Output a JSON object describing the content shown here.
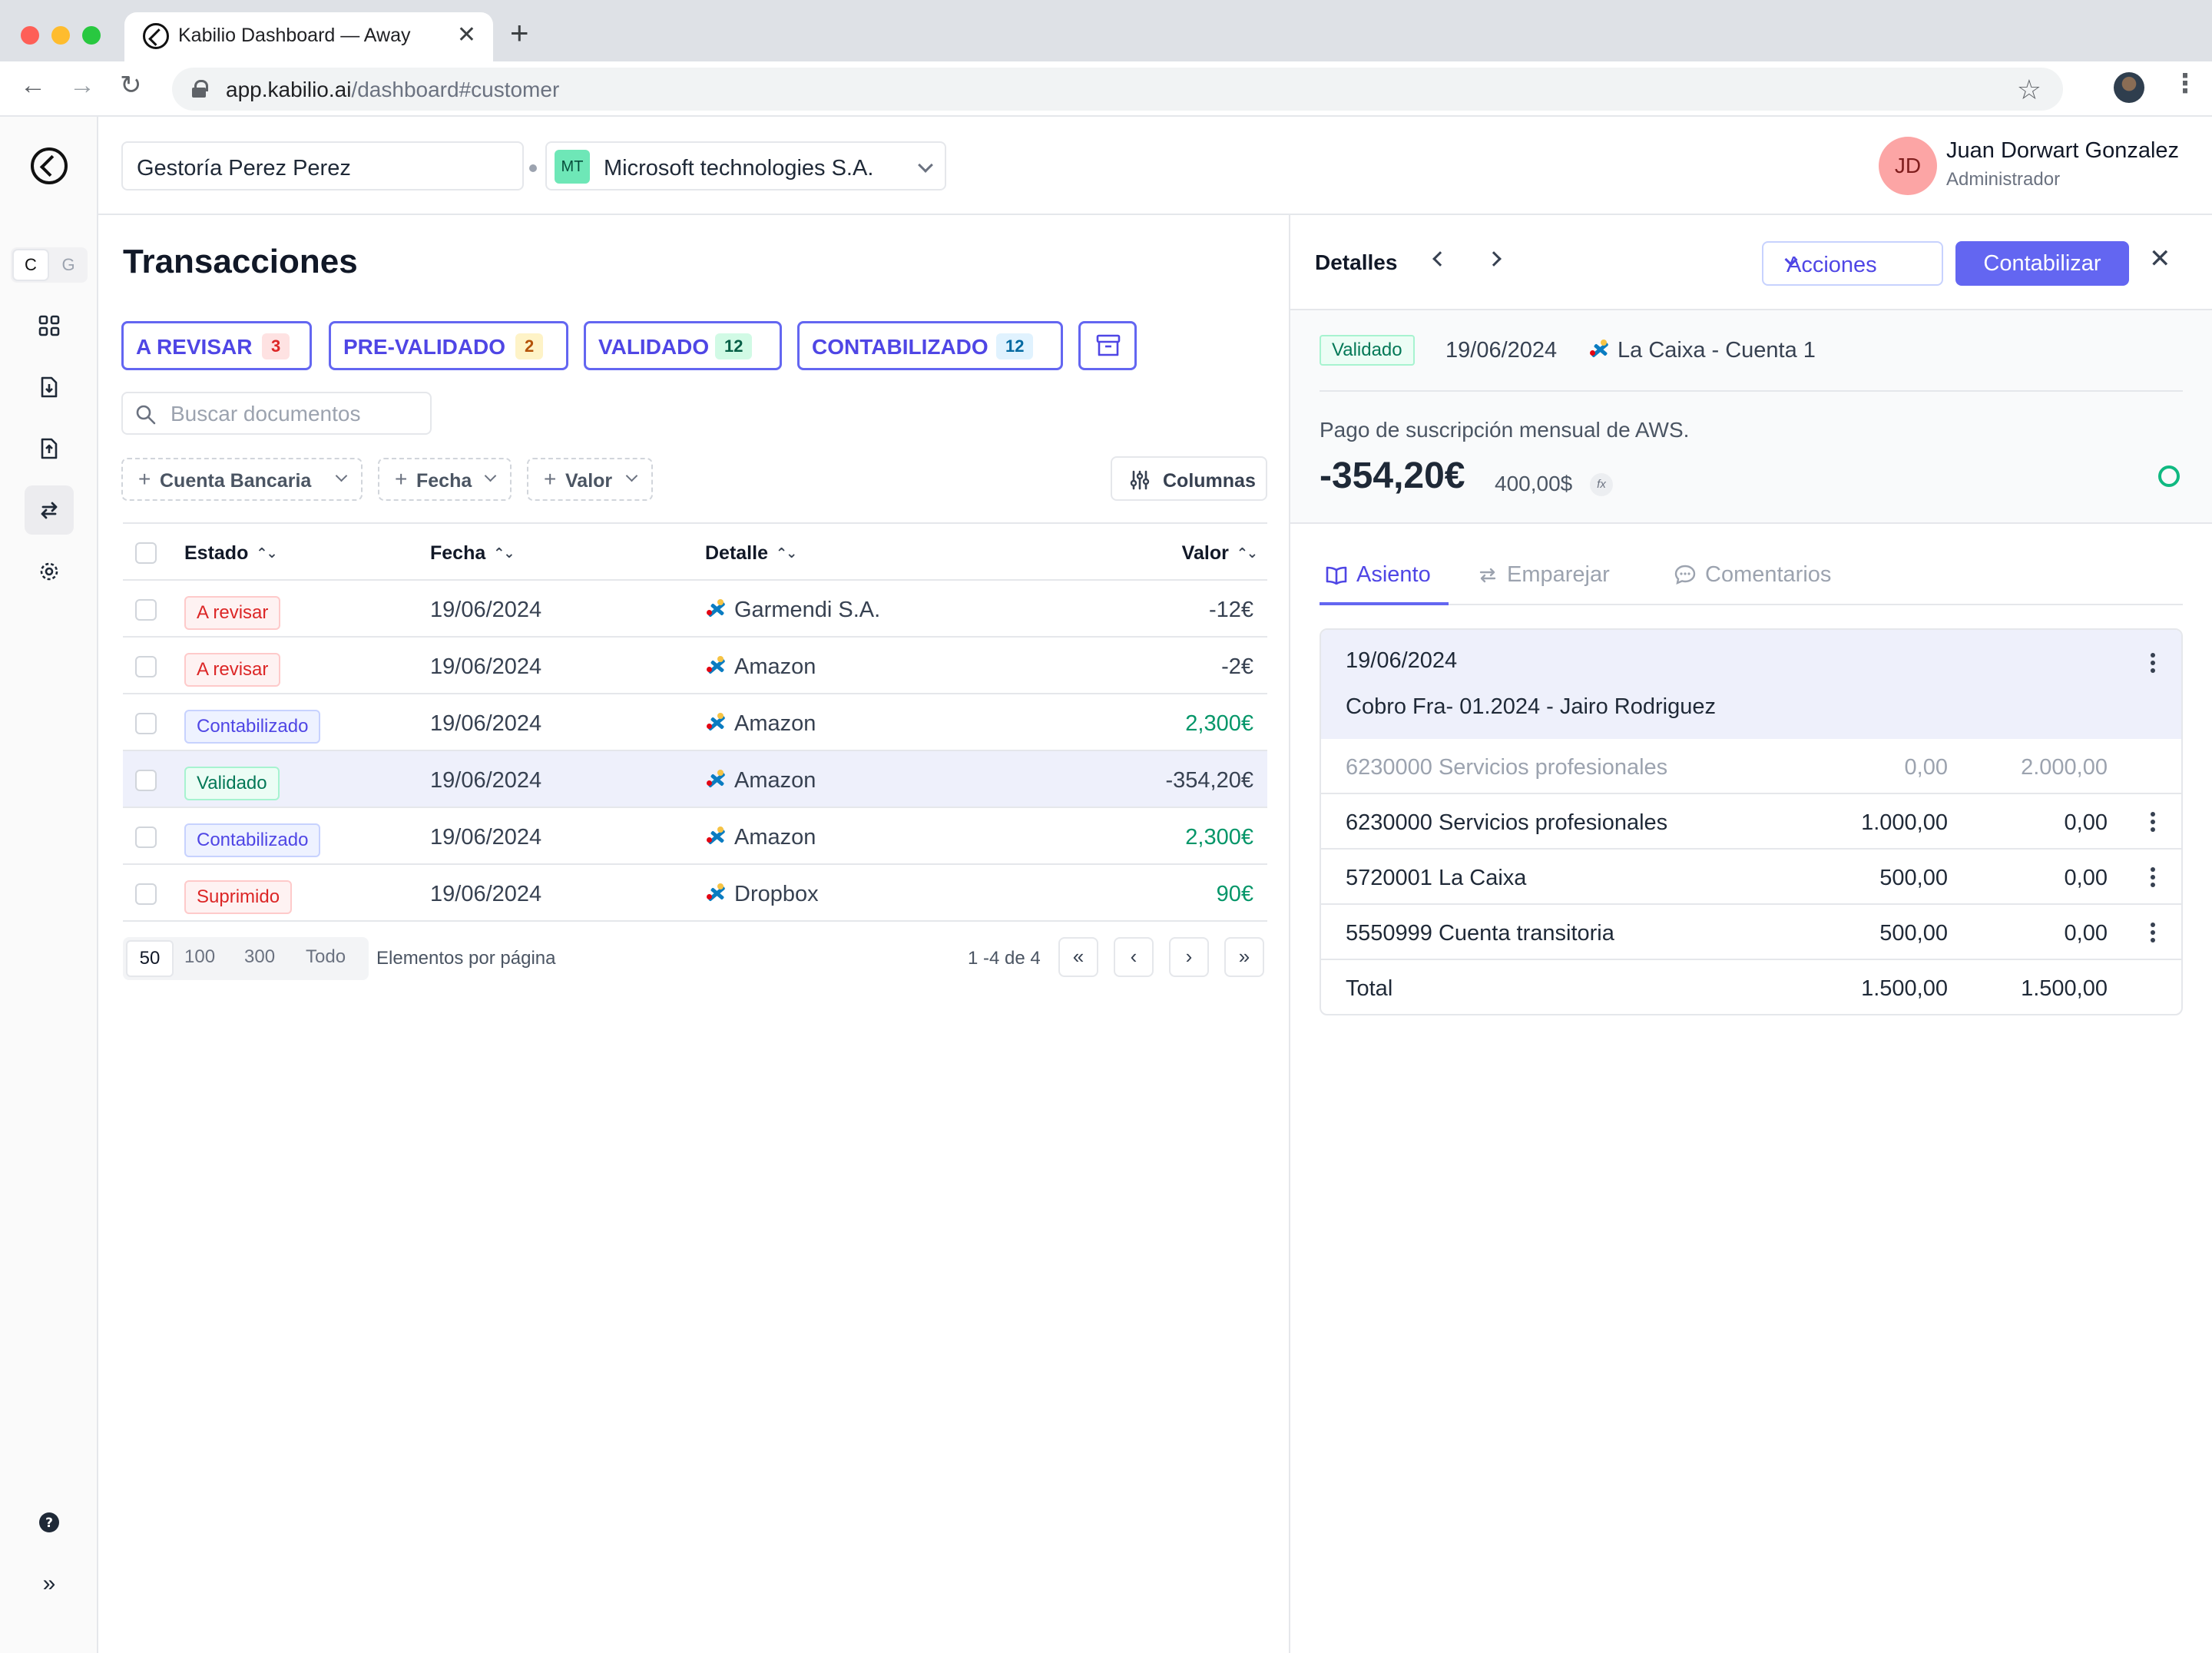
{
  "browser": {
    "tab_title": "Kabilio Dashboard — Away",
    "url_host": "app.kabilio.ai",
    "url_path": "/dashboard#customer"
  },
  "sidebar": {
    "toggle": [
      "C",
      "G"
    ],
    "items": [
      {
        "icon": "grid-icon"
      },
      {
        "icon": "document-download-icon"
      },
      {
        "icon": "document-upload-icon"
      },
      {
        "icon": "transfer-arrows-icon",
        "active": true
      },
      {
        "icon": "gear-icon"
      }
    ],
    "bottom": [
      {
        "icon": "help-icon"
      },
      {
        "icon": "expand-icon"
      }
    ]
  },
  "header": {
    "org_name": "Gestoría Perez Perez",
    "company_badge": "MT",
    "company_name": "Microsoft technologies S.A.",
    "user_initials": "JD",
    "user_name": "Juan Dorwart Gonzalez",
    "user_role": "Administrador"
  },
  "main": {
    "title": "Transacciones",
    "status_tabs": [
      {
        "label": "A REVISAR",
        "count": "3"
      },
      {
        "label": "PRE-VALIDADO",
        "count": "2"
      },
      {
        "label": "VALIDADO",
        "count": "12"
      },
      {
        "label": "CONTABILIZADO",
        "count": "12"
      }
    ],
    "search_placeholder": "Buscar documentos",
    "filters": [
      "Cuenta Bancaria",
      "Fecha",
      "Valor"
    ],
    "columns_button": "Columnas",
    "table": {
      "headers": {
        "estado": "Estado",
        "fecha": "Fecha",
        "detalle": "Detalle",
        "valor": "Valor"
      },
      "rows": [
        {
          "estado": "A revisar",
          "fecha": "19/06/2024",
          "detalle": "Garmendi S.A.",
          "valor": "-12€"
        },
        {
          "estado": "A revisar",
          "fecha": "19/06/2024",
          "detalle": "Amazon",
          "valor": "-2€"
        },
        {
          "estado": "Contabilizado",
          "fecha": "19/06/2024",
          "detalle": "Amazon",
          "valor": "2,300€"
        },
        {
          "estado": "Validado",
          "fecha": "19/06/2024",
          "detalle": "Amazon",
          "valor": "-354,20€"
        },
        {
          "estado": "Contabilizado",
          "fecha": "19/06/2024",
          "detalle": "Amazon",
          "valor": "2,300€"
        },
        {
          "estado": "Suprimido",
          "fecha": "19/06/2024",
          "detalle": "Dropbox",
          "valor": "90€"
        }
      ]
    },
    "pagination": {
      "page_sizes": [
        "50",
        "100",
        "300",
        "Todo"
      ],
      "page_size_label": "Elementos por página",
      "range": "1 -4 de 4"
    }
  },
  "details": {
    "title": "Detalles",
    "acciones_label": "Acciones",
    "contabilizar_label": "Contabilizar",
    "status": "Validado",
    "date": "19/06/2024",
    "account": "La Caixa - Cuenta 1",
    "description": "Pago de suscripción mensual de AWS.",
    "amount": "-354,20€",
    "fx_amount": "400,00$",
    "fx_badge": "fx",
    "tabs": [
      "Asiento",
      "Emparejar",
      "Comentarios"
    ],
    "entry": {
      "date": "19/06/2024",
      "description": "Cobro Fra- 01.2024 - Jairo Rodriguez",
      "lines": [
        {
          "account": "6230000 Servicios profesionales",
          "debit": "0,00",
          "credit": "2.000,00"
        },
        {
          "account": "6230000 Servicios profesionales",
          "debit": "1.000,00",
          "credit": "0,00"
        },
        {
          "account": "5720001 La Caixa",
          "debit": "500,00",
          "credit": "0,00"
        },
        {
          "account": "5550999 Cuenta transitoria",
          "debit": "500,00",
          "credit": "0,00"
        }
      ],
      "total_label": "Total",
      "total_debit": "1.500,00",
      "total_credit": "1.500,00"
    }
  }
}
